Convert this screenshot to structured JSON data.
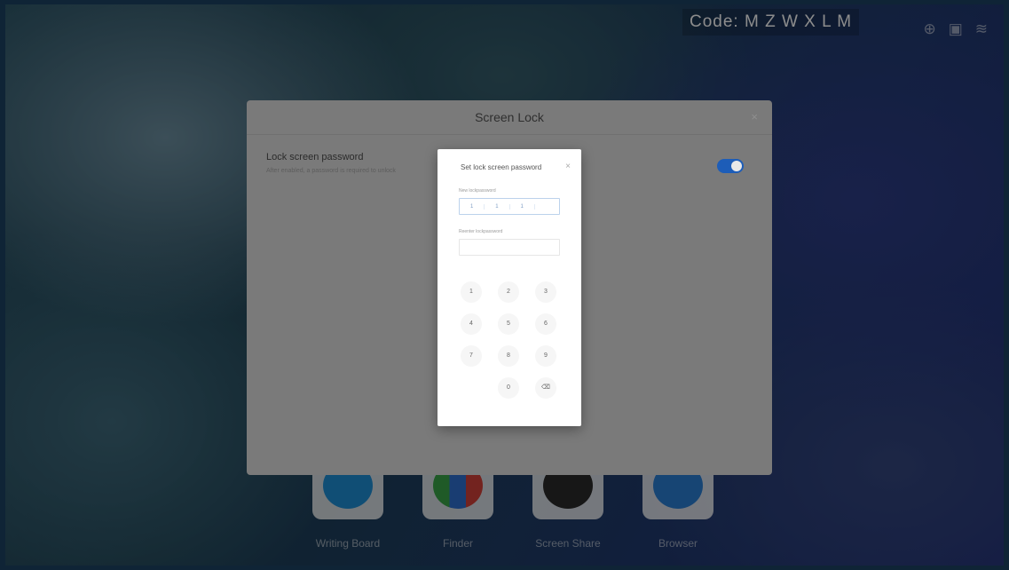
{
  "status_bar": {
    "code_label": "Code: M Z W X L M",
    "icons": [
      "headset-icon",
      "storage-icon",
      "wifi-icon"
    ]
  },
  "dock": {
    "apps": [
      {
        "label": "Writing Board",
        "icon": "writing-board-icon",
        "color": "#1e8fd6"
      },
      {
        "label": "Finder",
        "icon": "finder-icon",
        "color": "#d2413a"
      },
      {
        "label": "Screen Share",
        "icon": "screen-share-icon",
        "color": "#2b2b2b"
      },
      {
        "label": "Browser",
        "icon": "browser-icon",
        "color": "#2b7fd4"
      }
    ]
  },
  "screen_lock_panel": {
    "title": "Screen Lock",
    "close_glyph": "×",
    "row_title": "Lock screen password",
    "row_subtitle": "After enabled, a password is required to unlock",
    "toggle_on": true,
    "accent_color": "#1d5db8"
  },
  "password_dialog": {
    "title": "Set lock screen password",
    "close_glyph": "×",
    "new_password_label": "New lockpassword",
    "new_password_value": [
      "1",
      "1",
      "1"
    ],
    "confirm_password_label": "Reenter lockpassword",
    "keys": [
      "1",
      "2",
      "3",
      "4",
      "5",
      "6",
      "7",
      "8",
      "9",
      "0",
      "⌫"
    ]
  }
}
